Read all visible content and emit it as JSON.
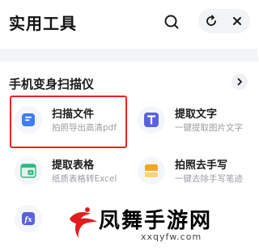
{
  "header": {
    "title": "实用工具",
    "icons": {
      "search": "search-icon",
      "refresh": "refresh-icon",
      "close": "close-icon"
    }
  },
  "section": {
    "title": "手机变身扫描仪",
    "more_icon": "chevron-right-icon"
  },
  "tools": [
    {
      "name": "扫描文件",
      "desc": "拍照导出高清pdf",
      "icon": "document-scan-icon",
      "color": "#3f7cf5",
      "highlighted": true
    },
    {
      "name": "提取文字",
      "desc": "一键提取图片文字",
      "icon": "text-extract-icon",
      "color": "#5a63d9"
    },
    {
      "name": "提取表格",
      "desc": "纸质表格转Excel",
      "icon": "table-extract-icon",
      "color": "#2fb87e"
    },
    {
      "name": "拍照去手写",
      "desc": "一键去除手写笔迹",
      "icon": "remove-handwriting-icon",
      "color": "#f5a623"
    },
    {
      "name": "",
      "desc": "",
      "icon": "formula-icon",
      "color": "#5a5fe0"
    }
  ],
  "watermark": {
    "text": "凤舞手游网",
    "url": "xxqyfw.com"
  },
  "colors": {
    "highlight": "#e82322",
    "divider": "#f4f5f7",
    "desc_text": "#9a9ca2"
  }
}
